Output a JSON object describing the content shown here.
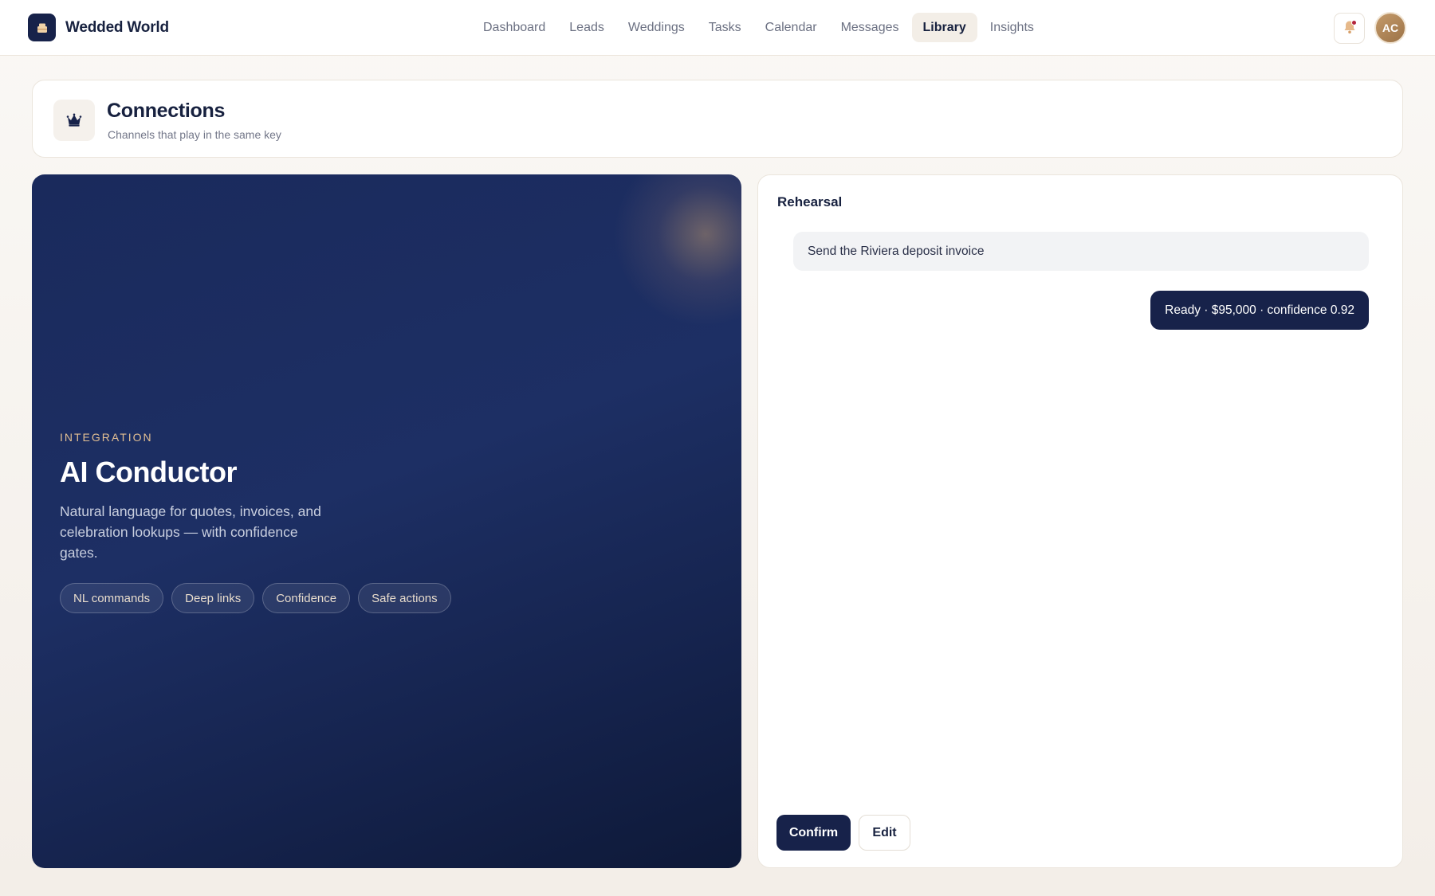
{
  "app": {
    "name": "Wedded World",
    "logo_icon": "cake-icon"
  },
  "nav": {
    "items": [
      {
        "label": "Dashboard",
        "active": false
      },
      {
        "label": "Leads",
        "active": false
      },
      {
        "label": "Weddings",
        "active": false
      },
      {
        "label": "Tasks",
        "active": false
      },
      {
        "label": "Calendar",
        "active": false
      },
      {
        "label": "Messages",
        "active": false
      },
      {
        "label": "Library",
        "active": true
      },
      {
        "label": "Insights",
        "active": false
      }
    ]
  },
  "header_actions": {
    "notifications_icon": "bell-icon",
    "has_unread": true,
    "avatar_initials": "AC"
  },
  "page": {
    "icon": "crown-icon",
    "title": "Connections",
    "subtitle": "Channels that play in the same key"
  },
  "hero": {
    "eyebrow": "INTEGRATION",
    "title": "AI Conductor",
    "description": "Natural language for quotes, invoices, and celebration lookups — with confidence gates.",
    "chips": [
      "NL commands",
      "Deep links",
      "Confidence",
      "Safe actions"
    ]
  },
  "rehearsal": {
    "title": "Rehearsal",
    "user_message": "Send the Riviera deposit invoice",
    "assistant_message": "Ready · $95,000 · confidence 0.92",
    "confirm_label": "Confirm",
    "edit_label": "Edit"
  },
  "colors": {
    "navy": "#17224a",
    "gold": "#e2bf93",
    "page_bg": "#faf8f5",
    "alert": "#b3243c"
  }
}
